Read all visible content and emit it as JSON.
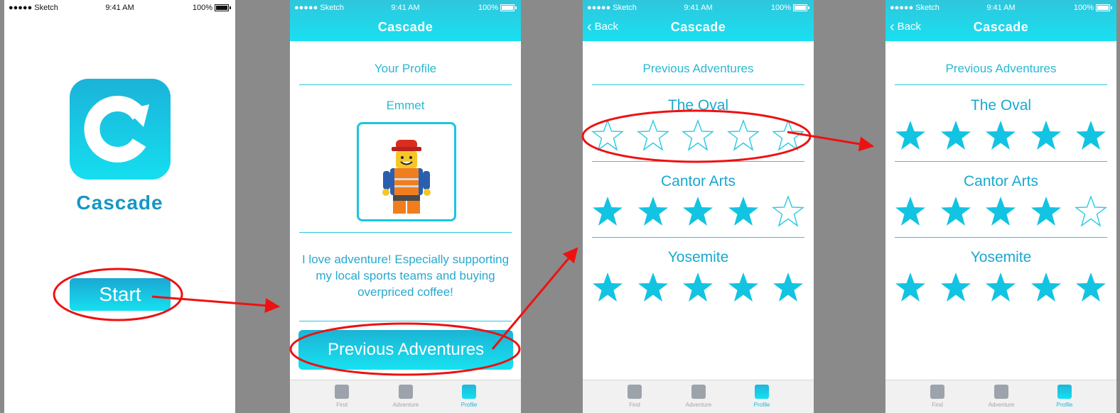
{
  "status": {
    "carrier": "●●●●● Sketch",
    "time": "9:41 AM",
    "battery": "100%"
  },
  "app": {
    "name": "Cascade",
    "brand_color": "#1bb3d8"
  },
  "screen1": {
    "start_label": "Start"
  },
  "screen2": {
    "title": "Cascade",
    "heading": "Your Profile",
    "user_name": "Emmet",
    "bio": "I love adventure! Especially supporting my local sports teams and buying overpriced coffee!",
    "button_label": "Previous Adventures"
  },
  "screen3": {
    "title": "Cascade",
    "back_label": "Back",
    "heading": "Previous Adventures",
    "adventures": [
      {
        "name": "The Oval",
        "rating": 0
      },
      {
        "name": "Cantor Arts",
        "rating": 4
      },
      {
        "name": "Yosemite",
        "rating": 5
      }
    ]
  },
  "screen4": {
    "title": "Cascade",
    "back_label": "Back",
    "heading": "Previous Adventures",
    "adventures": [
      {
        "name": "The Oval",
        "rating": 5
      },
      {
        "name": "Cantor Arts",
        "rating": 4
      },
      {
        "name": "Yosemite",
        "rating": 5
      }
    ]
  },
  "tabs": [
    {
      "label": "Find",
      "icon": "find-icon"
    },
    {
      "label": "Adventure",
      "icon": "adventure-icon"
    },
    {
      "label": "Profile",
      "icon": "profile-icon"
    }
  ],
  "max_rating": 5,
  "annotation_color": "#ee1111"
}
